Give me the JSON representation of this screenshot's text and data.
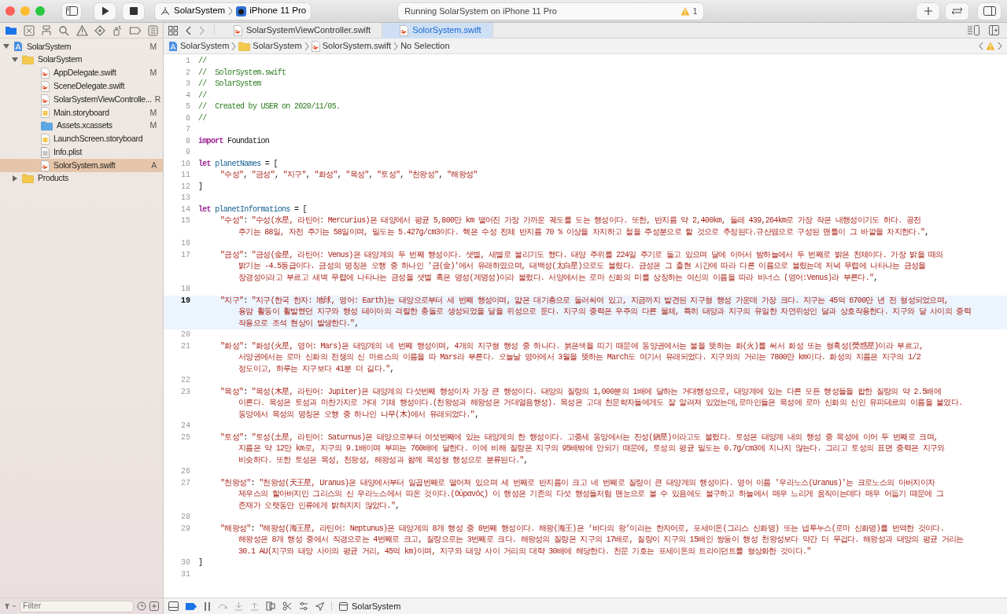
{
  "toolbar": {
    "scheme": {
      "target": "SolarSystem",
      "device": "iPhone 11 Pro"
    },
    "activity": {
      "status": "Running SolarSystem on iPhone 11 Pro",
      "warnings": "1"
    }
  },
  "navigator": {
    "tabs": [
      {
        "kind": "project",
        "selected": true
      },
      {
        "kind": "source-control",
        "selected": false
      },
      {
        "kind": "symbol",
        "selected": false
      },
      {
        "kind": "find",
        "selected": false
      },
      {
        "kind": "issue",
        "selected": false
      },
      {
        "kind": "test",
        "selected": false
      },
      {
        "kind": "debug",
        "selected": false
      },
      {
        "kind": "breakpoint",
        "selected": false
      },
      {
        "kind": "report",
        "selected": false
      }
    ],
    "tree": [
      {
        "label": "SolarSystem",
        "kind": "project",
        "status": "M",
        "expanded": true,
        "selected": false,
        "children": [
          {
            "label": "SolarSystem",
            "kind": "folder",
            "expanded": true,
            "selected": false,
            "children": [
              {
                "label": "AppDelegate.swift",
                "kind": "swift",
                "status": "M",
                "selected": false
              },
              {
                "label": "SceneDelegate.swift",
                "kind": "swift",
                "selected": false
              },
              {
                "label": "SolarSystemViewControlle...",
                "kind": "swift",
                "status": "R",
                "selected": false
              },
              {
                "label": "Main.storyboard",
                "kind": "storyboard",
                "status": "M",
                "selected": false
              },
              {
                "label": "Assets.xcassets",
                "kind": "assets",
                "status": "M",
                "selected": false
              },
              {
                "label": "LaunchScreen.storyboard",
                "kind": "storyboard",
                "selected": false
              },
              {
                "label": "Info.plist",
                "kind": "plist",
                "selected": false
              },
              {
                "label": "SolorSystem.swift",
                "kind": "swift",
                "status": "A",
                "selected": true
              }
            ]
          },
          {
            "label": "Products",
            "kind": "folder",
            "expanded": false,
            "selected": false
          }
        ]
      }
    ],
    "filter": {
      "placeholder": "Filter"
    }
  },
  "editor": {
    "tabs": [
      {
        "label": "SolarSystemViewController.swift",
        "selected": false
      },
      {
        "label": "SolorSystem.swift",
        "selected": true
      }
    ],
    "jump_bar": [
      {
        "kind": "project",
        "label": "SolarSystem"
      },
      {
        "kind": "folder",
        "label": "SolarSystem"
      },
      {
        "kind": "swift",
        "label": "SolorSystem.swift"
      },
      {
        "kind": "none",
        "label": "No Selection"
      }
    ],
    "lines": [
      {
        "number": "1",
        "current": false,
        "tokens": [
          {
            "kind": "comment",
            "text": "//"
          }
        ]
      },
      {
        "number": "2",
        "current": false,
        "tokens": [
          {
            "kind": "comment",
            "text": "//  SolorSystem.swift"
          }
        ]
      },
      {
        "number": "3",
        "current": false,
        "tokens": [
          {
            "kind": "comment",
            "text": "//  SolarSystem"
          }
        ]
      },
      {
        "number": "4",
        "current": false,
        "tokens": [
          {
            "kind": "comment",
            "text": "//"
          }
        ]
      },
      {
        "number": "5",
        "current": false,
        "tokens": [
          {
            "kind": "comment",
            "text": "//  Created by USER on 2020/11/05."
          }
        ]
      },
      {
        "number": "6",
        "current": false,
        "tokens": [
          {
            "kind": "comment",
            "text": "//"
          }
        ]
      },
      {
        "number": "7",
        "current": false
      },
      {
        "number": "8",
        "current": false,
        "tokens": [
          {
            "kind": "keyword",
            "text": "import"
          },
          {
            "kind": "plain",
            "text": " Foundation"
          }
        ]
      },
      {
        "number": "9",
        "current": false
      },
      {
        "number": "10",
        "current": false,
        "tokens": [
          {
            "kind": "keyword",
            "text": "let "
          },
          {
            "kind": "declaration",
            "text": "planetNames"
          },
          {
            "kind": "plain",
            "text": " = ["
          }
        ]
      },
      {
        "number": "11",
        "current": false,
        "indented": true,
        "tokens": [
          {
            "kind": "string",
            "text": "\"수성\""
          },
          {
            "kind": "plain",
            "text": ", "
          },
          {
            "kind": "string",
            "text": "\"금성\""
          },
          {
            "kind": "plain",
            "text": ", "
          },
          {
            "kind": "string",
            "text": "\"지구\""
          },
          {
            "kind": "plain",
            "text": ", "
          },
          {
            "kind": "string",
            "text": "\"화성\""
          },
          {
            "kind": "plain",
            "text": ", "
          },
          {
            "kind": "string",
            "text": "\"목성\""
          },
          {
            "kind": "plain",
            "text": ", "
          },
          {
            "kind": "string",
            "text": "\"토성\""
          },
          {
            "kind": "plain",
            "text": ", "
          },
          {
            "kind": "string",
            "text": "\"천왕성\""
          },
          {
            "kind": "plain",
            "text": ", "
          },
          {
            "kind": "string",
            "text": "\"해왕성\""
          }
        ]
      },
      {
        "number": "12",
        "current": false,
        "tokens": [
          {
            "kind": "plain",
            "text": "]"
          }
        ]
      },
      {
        "number": "13",
        "current": false
      },
      {
        "number": "14",
        "current": false,
        "tokens": [
          {
            "kind": "keyword",
            "text": "let "
          },
          {
            "kind": "declaration",
            "text": "planetInformations"
          },
          {
            "kind": "plain",
            "text": " = ["
          }
        ]
      },
      {
        "number": "15",
        "current": false,
        "indented": true,
        "tokens": [
          {
            "kind": "string",
            "text": "\"수성\""
          },
          {
            "kind": "plain",
            "text": ": "
          },
          {
            "kind": "string",
            "text": "\"수성(水星, 라틴어: Mercurius)은 태양에서 평균 5,800만 km 떨어진 가장 가까운 궤도를 도는 행성이다. 또한, 반지름 약 2,400km, 둘레 439,264km로 가장 작은 내행성이기도 하다. 공전"
          },
          {
            "kind": "string",
            "wrapped": true,
            "text": "주기는 88일, 자전 주기는 58일이며, 밀도는 5.427g/cm3이다. 핵은 수성 전체 반지름 70 % 이상을 차지하고 철을 주성분으로 할 것으로 추정된다.규산염으로 구성된 맨틀이 그 바깥을 차지한다.\""
          },
          {
            "kind": "plain",
            "text": ","
          }
        ]
      },
      {
        "number": "16",
        "current": false
      },
      {
        "number": "17",
        "current": false,
        "indented": true,
        "tokens": [
          {
            "kind": "string",
            "text": "\"금성\""
          },
          {
            "kind": "plain",
            "text": ": "
          },
          {
            "kind": "string",
            "text": "\"금성(金星, 라틴어: Venus)은 태양계의 두 번째 행성이다. 샛별, 새별로 불리기도 했다. 태양 주위를 224일 주기로 돌고 있으며 달에 이어서 밤하늘에서 두 번째로 밝은 천체이다. 가장 밝을 때의"
          },
          {
            "kind": "string",
            "wrapped": true,
            "text": "밝기는 -4.5등급이다. 금성의 명칭은 오행 중 하나인 '금(金)'에서 유래하였으며, 태백성(太白星)으로도 불렸다. 금성은 그 출현 시간에 따라 다른 이름으로 불렸는데 저녁 무렵에 나타나는 금성을"
          },
          {
            "kind": "string",
            "wrapped": true,
            "text": "장경성이라고 부르고 새벽 무렵에 나타나는 금성을 샛별 혹은 명성(계명성)이라 불렀다. 서양에서는 로마 신화의 미를 상징하는 여신의 이름을 따라 비너스 (영어:Venus)라 부른다.\""
          },
          {
            "kind": "plain",
            "text": ","
          }
        ]
      },
      {
        "number": "18",
        "current": false
      },
      {
        "number": "19",
        "current": true,
        "indented": true,
        "tokens": [
          {
            "kind": "string",
            "text": "\"지구\""
          },
          {
            "kind": "plain",
            "text": ": "
          },
          {
            "kind": "string",
            "text": "\"지구(한국 한자: 地球, 영어: Earth)는 태양으로부터 세 번째 행성이며, 얇은 대기층으로 둘러싸여 있고, 지금까지 발견된 지구형 행성 가운데 가장 크다. 지구는 45억 6700만 년 전 형성되었으며,"
          },
          {
            "kind": "string",
            "wrapped": true,
            "text": "용암 활동이 활발했던 지구와 행성 테이아의 격렬한 충돌로 생성되었을 달을 위성으로 둔다. 지구의 중력은 우주의 다른 물체, 특히 태양과 지구의 유일한 자연위성인 달과 상호작용한다. 지구와 달 사이의 중력"
          },
          {
            "kind": "string",
            "wrapped": true,
            "text": "작용으로 조석 현상이 발생한다.\""
          },
          {
            "kind": "plain",
            "text": ","
          }
        ]
      },
      {
        "number": "20",
        "current": false
      },
      {
        "number": "21",
        "current": false,
        "indented": true,
        "tokens": [
          {
            "kind": "string",
            "text": "\"화성\""
          },
          {
            "kind": "plain",
            "text": ": "
          },
          {
            "kind": "string",
            "text": "\"화성(火星, 영어: Mars)은 태양계의 네 번째 행성이며, 4개의 지구형 행성 중 하나다. 붉은색을 띠기 때문에 동양권에서는 불을 뜻하는 화(火)를 써서 화성 또는 형혹성(熒惑星)이라 부르고,"
          },
          {
            "kind": "string",
            "wrapped": true,
            "text": "서양권에서는 로마 신화의 전쟁의 신 마르스의 이름을 따 Mars라 부른다. 오늘날 영어에서 3월을 뜻하는 March도 여기서 유래되었다. 지구와의 거리는 7800만 km이다. 화성의 지름은 지구의 1/2"
          },
          {
            "kind": "string",
            "wrapped": true,
            "text": "정도이고, 하루는 지구보다 41분 더 길다.\""
          },
          {
            "kind": "plain",
            "text": ","
          }
        ]
      },
      {
        "number": "22",
        "current": false
      },
      {
        "number": "23",
        "current": false,
        "indented": true,
        "tokens": [
          {
            "kind": "string",
            "text": "\"목성\""
          },
          {
            "kind": "plain",
            "text": ": "
          },
          {
            "kind": "string",
            "text": "\"목성(木星, 라틴어: Jupiter)은 태양계의 다섯번째 행성이자 가장 큰 행성이다. 태양의 질량의 1,000분의 1배에 달하는 거대행성으로, 태양계에 있는 다른 모든 행성들을 합한 질량의 약 2.5배에"
          },
          {
            "kind": "string",
            "wrapped": true,
            "text": "이른다. 목성은 토성과 마찬가지로 거대 기체 행성이다.(천왕성과 해왕성은 거대얼음행성). 목성은 고대 천문학자들에게도 잘 알려져 있었는데,로마인들은 목성에 로마 신화의 신인 유피테르의 이름을 붙였다."
          },
          {
            "kind": "string",
            "wrapped": true,
            "text": "동양에서 목성의 명칭은 오행 중 하나인 나무(木)에서 유래되었다.\""
          },
          {
            "kind": "plain",
            "text": ","
          }
        ]
      },
      {
        "number": "24",
        "current": false
      },
      {
        "number": "25",
        "current": false,
        "indented": true,
        "tokens": [
          {
            "kind": "string",
            "text": "\"토성\""
          },
          {
            "kind": "plain",
            "text": ": "
          },
          {
            "kind": "string",
            "text": "\"토성(土星, 라틴어: Saturnus)은 태양으로부터 여섯번째에 있는 태양계의 한 행성이다. 고중세 동양에서는 진성(鎭星)이라고도 불렀다. 토성은 태양계 내의 행성 중 목성에 이어 두 번째로 크며,"
          },
          {
            "kind": "string",
            "wrapped": true,
            "text": "지름은 약 12만 km로, 지구의 9.1배이며 부피는 760배에 달한다. 이에 비해 질량은 지구의 95배밖에 안되기 때문에, 토성의 평균 밀도는 0.7g/cm3에 지나지 않는다. 그리고 토성의 표면 중력은 지구와"
          },
          {
            "kind": "string",
            "wrapped": true,
            "text": "비슷하다. 또한 토성은 목성, 천왕성, 해왕성과 함께 목성형 행성으로 분류된다.\""
          },
          {
            "kind": "plain",
            "text": ","
          }
        ]
      },
      {
        "number": "26",
        "current": false
      },
      {
        "number": "27",
        "current": false,
        "indented": true,
        "tokens": [
          {
            "kind": "string",
            "text": "\"천왕성\""
          },
          {
            "kind": "plain",
            "text": ": "
          },
          {
            "kind": "string",
            "text": "\"천왕성(天王星, Uranus)은 태양에서부터 일곱번째로 떨어져 있으며 세 번째로 반지름이 크고 네 번째로 질량이 큰 태양계의 행성이다. 영어 이름 '우라노스(Uranus)'는 크로노스의 아버지이자"
          },
          {
            "kind": "string",
            "wrapped": true,
            "text": "제우스의 할아버지인 그리스의 신 우라노스에서 따온 것이다.(Οὐρανός) 이 행성은 기존의 다섯 행성들처럼 맨눈으로 볼 수 있음에도 불구하고 하늘에서 매우 느리게 움직이는데다 매우 어둡기 때문에 그"
          },
          {
            "kind": "string",
            "wrapped": true,
            "text": "존재가 오랫동안 인류에게 밝혀지지 않았다.\""
          },
          {
            "kind": "plain",
            "text": ","
          }
        ]
      },
      {
        "number": "28",
        "current": false
      },
      {
        "number": "29",
        "current": false,
        "indented": true,
        "tokens": [
          {
            "kind": "string",
            "text": "\"해왕성\""
          },
          {
            "kind": "plain",
            "text": ": "
          },
          {
            "kind": "string",
            "text": "\"해왕성(海王星, 라틴어: Neptunus)은 태양계의 8개 행성 중 8번째 행성이다. 해왕(海王)은 ‘바다의 왕’이라는 한자어로, 포세이돈(그리스 신화명) 또는 넵투누스(로마 신화명)를 번역한 것이다."
          },
          {
            "kind": "string",
            "wrapped": true,
            "text": "해왕성은 8개 행성 중에서 직경으로는 4번째로 크고, 질량으로는 3번째로 크다. 해왕성의 질량은 지구의 17배로, 질량이 지구의 15배인 쌍둥이 행성 천왕성보다 약간 더 무겁다. 해왕성과 태양의 평균 거리는"
          },
          {
            "kind": "string",
            "wrapped": true,
            "text": "30.1 AU(지구와 태양 사이의 평균 거리, 45억 km)이며, 지구와 태양 사이 거리의 대략 30배에 해당한다. 천문 기호는 포세이돈의 트라이던트를 형상화한 것이다.\""
          }
        ]
      },
      {
        "number": "30",
        "current": false,
        "tokens": [
          {
            "kind": "plain",
            "text": "]"
          }
        ]
      },
      {
        "number": "31",
        "current": false
      }
    ]
  },
  "debug_bar": {
    "scheme": "SolarSystem"
  }
}
